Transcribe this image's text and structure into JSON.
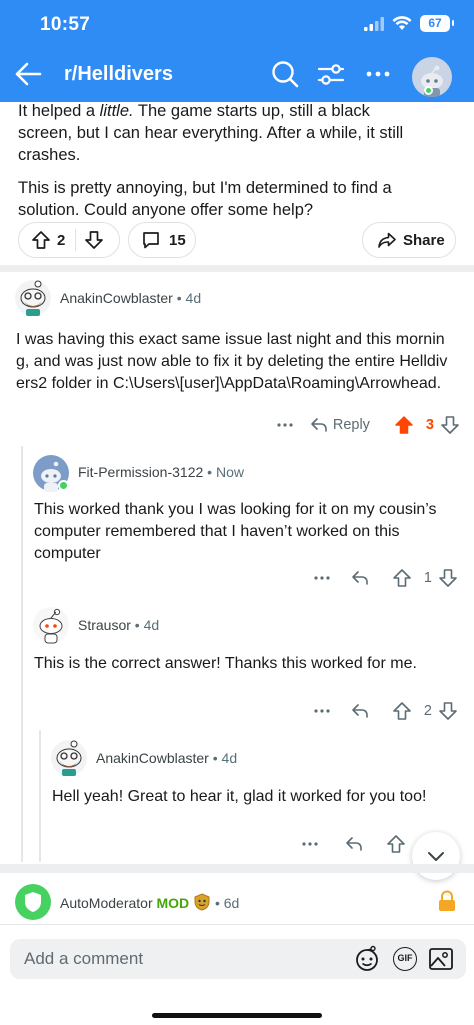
{
  "status_bar": {
    "time": "10:57",
    "battery": "67"
  },
  "header": {
    "subreddit": "r/Helldivers"
  },
  "post": {
    "lines_a_pre": "It helped a ",
    "lines_a_em": "little.",
    "lines_a_post": " The game starts up, still a black",
    "line_b": "screen, but I can hear everything. After a while, it still",
    "line_c": "crashes.",
    "para2_line1": "This is pretty annoying, but I'm determined to find a",
    "para2_line2": "solution. Could anyone offer some help?",
    "votes": "2",
    "comments": "15",
    "share_label": "Share"
  },
  "comments": [
    {
      "author": "AnakinCowblaster",
      "age": "4d",
      "body": "I was having this exact same issue last night and this morning, and was just now able to fix it by deleting the entire Helldivers2 folder in C:\\Users\\[user]\\AppData\\Roaming\\Arrowhead.",
      "reply_label": "Reply",
      "votes": "3"
    },
    {
      "author": "Fit-Permission-3122",
      "age": "Now",
      "body": "This worked thank you I was looking for it on my cousin’s computer remembered that I haven’t worked on this computer",
      "votes": "1"
    },
    {
      "author": "Strausor",
      "age": "4d",
      "body": "This is the correct answer! Thanks this worked for me.",
      "votes": "2"
    },
    {
      "author": "AnakinCowblaster",
      "age": "4d",
      "body": "Hell yeah! Great to hear it, glad it worked for you too!"
    },
    {
      "author": "AutoModerator",
      "badge": "MOD",
      "age": "6d"
    }
  ],
  "composer": {
    "placeholder": "Add a comment",
    "gif_label": "GIF"
  },
  "colors": {
    "header_blue": "#2f8cf5",
    "upvote_orange": "#ff4500",
    "mod_green": "#46a508"
  },
  "icons": [
    "back-arrow-icon",
    "search-icon",
    "filter-icon",
    "more-icon",
    "upvote-icon",
    "downvote-icon",
    "comment-icon",
    "share-icon",
    "reply-icon",
    "chevron-down-icon",
    "shield-icon",
    "lock-icon",
    "emoji-icon",
    "image-icon"
  ]
}
